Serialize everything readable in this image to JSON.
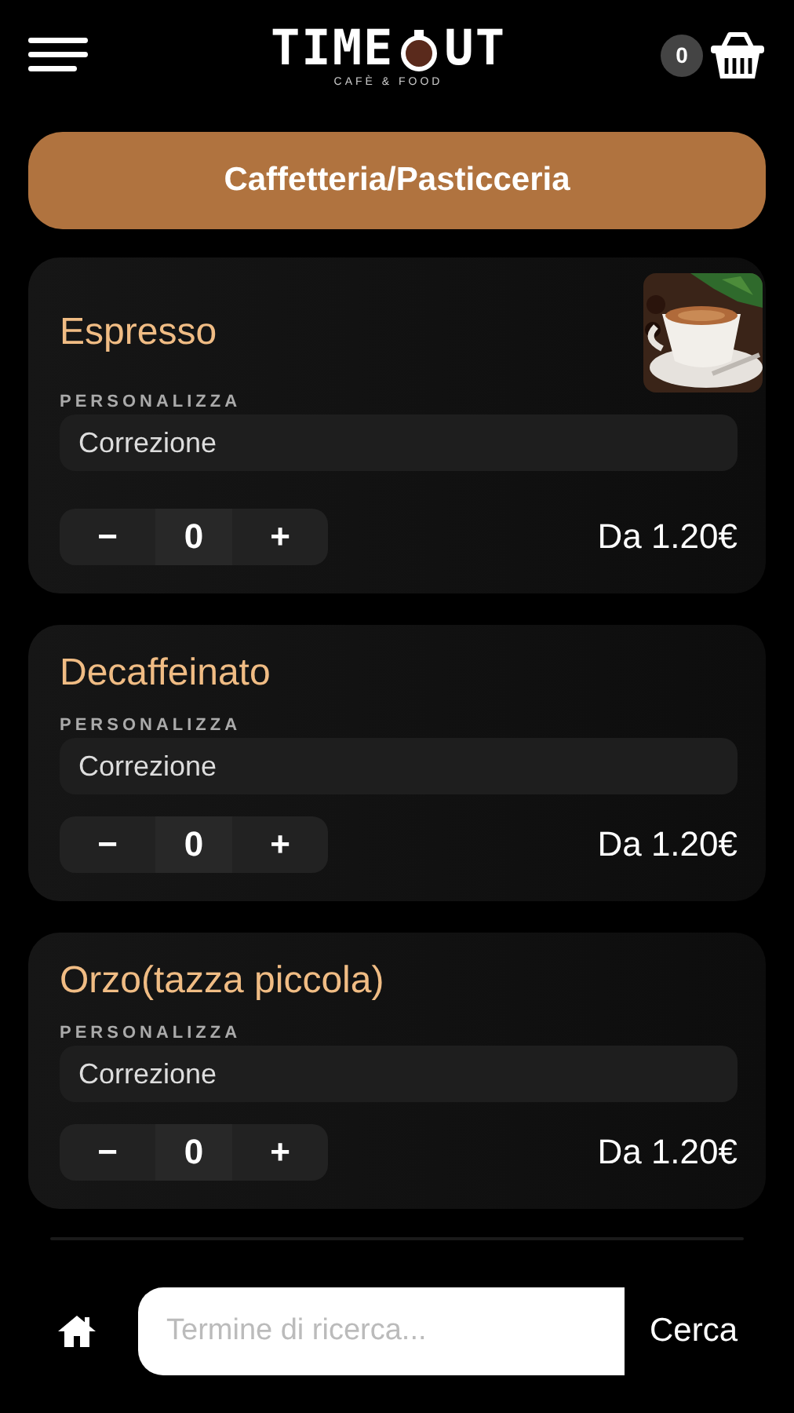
{
  "header": {
    "logo_left": "TIME",
    "logo_right": "UT",
    "logo_tagline": "CAFÈ & FOOD",
    "cart_count": "0"
  },
  "category": "Caffetteria/Pasticceria",
  "products": [
    {
      "name": "Espresso",
      "has_picture": true,
      "custom_label": "PERSONALIZZA",
      "custom_value": "Correzione",
      "minus": "−",
      "quantity": "0",
      "plus": "+",
      "price": "Da 1.20€"
    },
    {
      "name": "Decaffeinato",
      "has_picture": false,
      "custom_label": "PERSONALIZZA",
      "custom_value": "Correzione",
      "minus": "−",
      "quantity": "0",
      "plus": "+",
      "price": "Da 1.20€"
    },
    {
      "name": "Orzo(tazza piccola)",
      "has_picture": false,
      "custom_label": "PERSONALIZZA",
      "custom_value": "Correzione",
      "minus": "−",
      "quantity": "0",
      "plus": "+",
      "price": "Da 1.20€"
    }
  ],
  "bottom_bar": {
    "search": {
      "placeholder": "Termine di ricerca..."
    },
    "search_button": "Cerca"
  }
}
